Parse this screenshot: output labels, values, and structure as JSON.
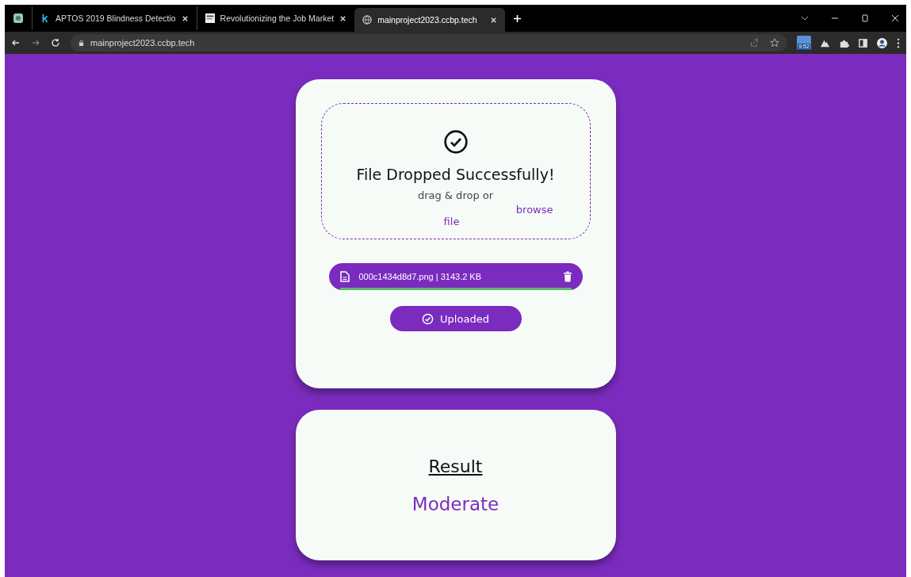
{
  "tabs": [
    {
      "title": "APTOS 2019 Blindness Detectio",
      "selected": false
    },
    {
      "title": "Revolutionizing the Job Market",
      "selected": false
    },
    {
      "title": "mainproject2023.ccbp.tech",
      "selected": true
    }
  ],
  "address": "mainproject2023.ccbp.tech",
  "extension_badge": "9:52",
  "upload": {
    "heading": "File Dropped Successfully!",
    "hint": "drag & drop or",
    "link_part1": "browse",
    "link_part2": "file",
    "file": {
      "name": "000c1434d8d7.png | 3143.2 KB",
      "level": 1
    },
    "status_button": "Uploaded"
  },
  "result": {
    "title": "Result",
    "value": "Moderate"
  }
}
